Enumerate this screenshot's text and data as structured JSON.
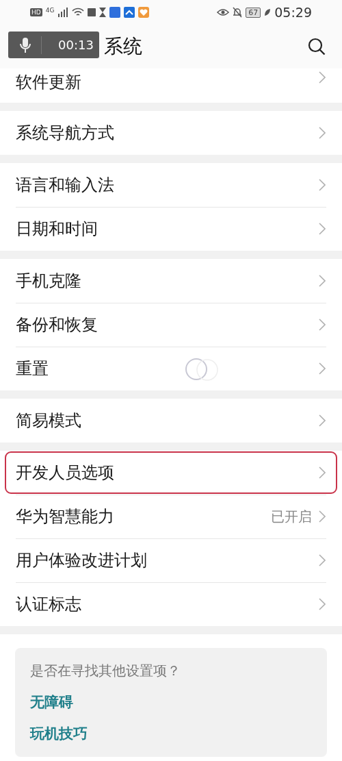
{
  "status_bar": {
    "hd": "HD",
    "time": "05:29",
    "battery": "67",
    "network": "4G"
  },
  "header": {
    "title": "系统"
  },
  "recorder": {
    "time": "00:13"
  },
  "groups": [
    {
      "items": [
        {
          "label": "软件更新",
          "highlighted": false
        }
      ]
    },
    {
      "items": [
        {
          "label": "系统导航方式",
          "highlighted": false
        }
      ]
    },
    {
      "items": [
        {
          "label": "语言和输入法",
          "highlighted": false
        },
        {
          "label": "日期和时间",
          "highlighted": false
        }
      ]
    },
    {
      "items": [
        {
          "label": "手机克隆",
          "highlighted": false
        },
        {
          "label": "备份和恢复",
          "highlighted": false
        },
        {
          "label": "重置",
          "highlighted": false,
          "touch": true
        }
      ]
    },
    {
      "items": [
        {
          "label": "简易模式",
          "highlighted": false
        }
      ]
    },
    {
      "items": [
        {
          "label": "开发人员选项",
          "highlighted": true
        },
        {
          "label": "华为智慧能力",
          "highlighted": false,
          "value": "已开启"
        },
        {
          "label": "用户体验改进计划",
          "highlighted": false
        },
        {
          "label": "认证标志",
          "highlighted": false
        }
      ]
    }
  ],
  "suggestions": {
    "question": "是否在寻找其他设置项？",
    "links": [
      "无障碍",
      "玩机技巧"
    ]
  }
}
